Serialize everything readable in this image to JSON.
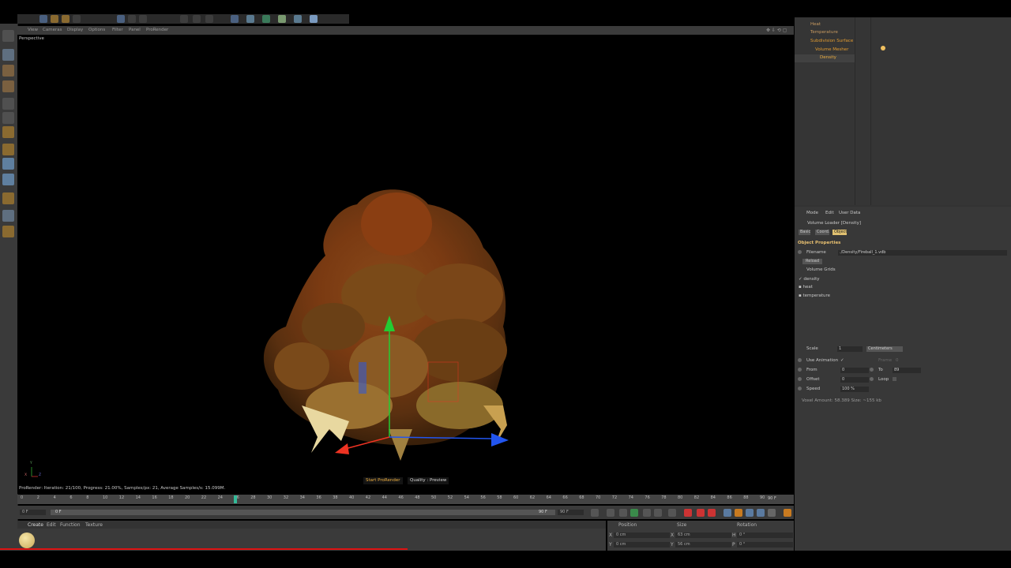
{
  "toolbar": {
    "icons": [
      "move-icon",
      "scale-icon",
      "rotate-icon",
      "undo-icon",
      "render-icon",
      "cube-icon",
      "sphere-icon",
      "light-icon",
      "camera-icon"
    ]
  },
  "viewport": {
    "menu": [
      "View",
      "Cameras",
      "Display",
      "Options",
      "Filter",
      "Panel",
      "ProRender"
    ],
    "label": "Perspective",
    "status": "ProRender: Iteration: 21/100, Progress: 21.00%, Samples/px: 21, Average Samples/s: 15.099M.",
    "start_button": "Start ProRender",
    "quality_button": "Quality : Preview",
    "axis_y": "Y",
    "axis_x": "X",
    "axis_z": "Z"
  },
  "timeline": {
    "ticks": [
      "0",
      "2",
      "4",
      "6",
      "8",
      "10",
      "12",
      "14",
      "16",
      "18",
      "20",
      "22",
      "24",
      "26",
      "28",
      "30",
      "32",
      "34",
      "36",
      "38",
      "40",
      "42",
      "44",
      "46",
      "48",
      "50",
      "52",
      "54",
      "56",
      "58",
      "60",
      "62",
      "64",
      "66",
      "68",
      "70",
      "72",
      "74",
      "76",
      "78",
      "80",
      "82",
      "84",
      "86",
      "88",
      "90"
    ],
    "end_label": "90 F",
    "current_frame": "0 F",
    "range_start": "0 F",
    "range_end": "90 F",
    "end_field": "90 F"
  },
  "material": {
    "menu": [
      "Create",
      "Edit",
      "Function",
      "Texture"
    ]
  },
  "coords": {
    "headers": [
      "Position",
      "Size",
      "Rotation"
    ],
    "row1": [
      "X",
      "0 cm",
      "X",
      "63 cm",
      "H",
      "0 °"
    ],
    "row2": [
      "Y",
      "0 cm",
      "Y",
      "56 cm",
      "P",
      "0 °"
    ]
  },
  "objects": {
    "rows": [
      "Heat",
      "Temperature",
      "Subdivision Surface",
      "Volume Mesher",
      "Density"
    ]
  },
  "attributes": {
    "menu": [
      "Mode",
      "Edit",
      "User Data"
    ],
    "title": "Volume Loader [Density]",
    "tabs": [
      "Basic",
      "Coord.",
      "Object"
    ],
    "section": "Object Properties",
    "filename_label": "Filename",
    "filename_value": "./Density/Fireball_1.vdb",
    "reload": "Reload",
    "grids_label": "Volume Grids",
    "grids": [
      "density",
      "heat",
      "temperature"
    ],
    "scale_label": "Scale",
    "scale_value": "1",
    "scale_unit": "Centimeters",
    "use_anim": "Use Animation",
    "frame_label": "Frame",
    "frame_value": "0",
    "from_label": "From",
    "from_value": "0",
    "to_label": "To",
    "to_value": "89",
    "offset_label": "Offset",
    "offset_value": "0",
    "loop_label": "Loop",
    "speed_label": "Speed",
    "speed_value": "100 %",
    "voxel_info": "Voxel Amount: 58.389   Size: ~155 kb"
  },
  "colors": {
    "accent": "#f0c060",
    "axis_green": "#22cc33",
    "axis_red": "#ee3322",
    "axis_blue": "#2255ee",
    "progress": "#d11111"
  }
}
